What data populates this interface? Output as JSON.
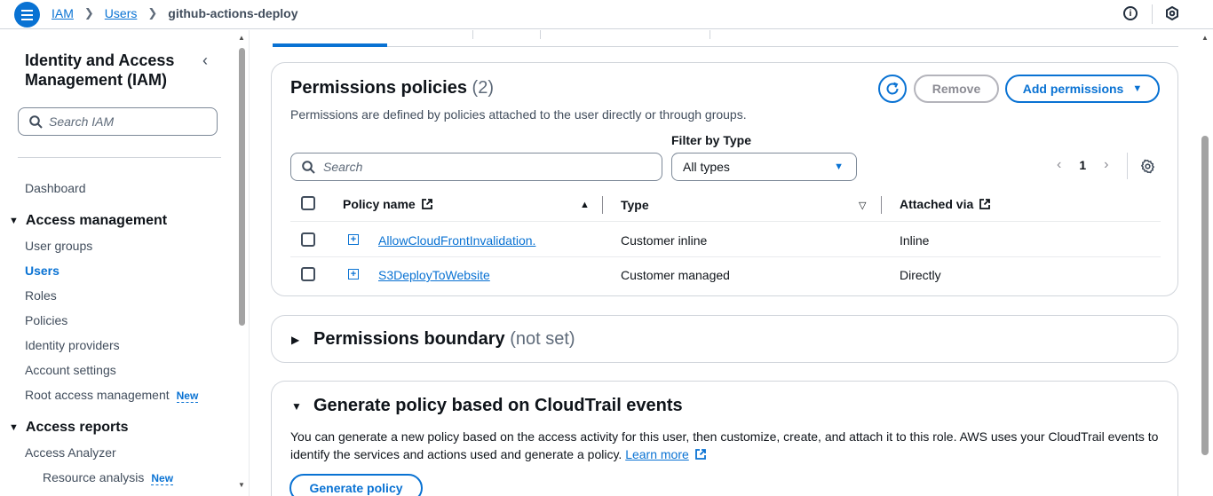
{
  "breadcrumb": {
    "root": "IAM",
    "parent": "Users",
    "current": "github-actions-deploy"
  },
  "sidebar": {
    "title": "Identity and Access Management (IAM)",
    "search_placeholder": "Search IAM",
    "dashboard": "Dashboard",
    "section_access_management": "Access management",
    "items": [
      "User groups",
      "Users",
      "Roles",
      "Policies",
      "Identity providers",
      "Account settings",
      "Root access management"
    ],
    "new_badge": "New",
    "section_access_reports": "Access reports",
    "report_items": [
      "Access Analyzer",
      "Resource analysis"
    ]
  },
  "permissions": {
    "title": "Permissions policies",
    "count": "(2)",
    "description": "Permissions are defined by policies attached to the user directly or through groups.",
    "remove_label": "Remove",
    "add_label": "Add permissions",
    "filter_label": "Filter by Type",
    "search_placeholder": "Search",
    "filter_value": "All types",
    "page": "1",
    "columns": {
      "name": "Policy name",
      "type": "Type",
      "attached": "Attached via"
    },
    "rows": [
      {
        "name": "AllowCloudFrontInvalidation.",
        "type": "Customer inline",
        "attached": "Inline"
      },
      {
        "name": "S3DeployToWebsite",
        "type": "Customer managed",
        "attached": "Directly"
      }
    ]
  },
  "boundary": {
    "title": "Permissions boundary",
    "status": "(not set)"
  },
  "generate": {
    "title": "Generate policy based on CloudTrail events",
    "description": "You can generate a new policy based on the access activity for this user, then customize, create, and attach it to this role. AWS uses your CloudTrail events to identify the services and actions used and generate a policy.",
    "learn_more": "Learn more",
    "button": "Generate policy"
  },
  "colors": {
    "accent": "#0972d3",
    "text": "#0f141a",
    "muted": "#5f6b7a"
  }
}
